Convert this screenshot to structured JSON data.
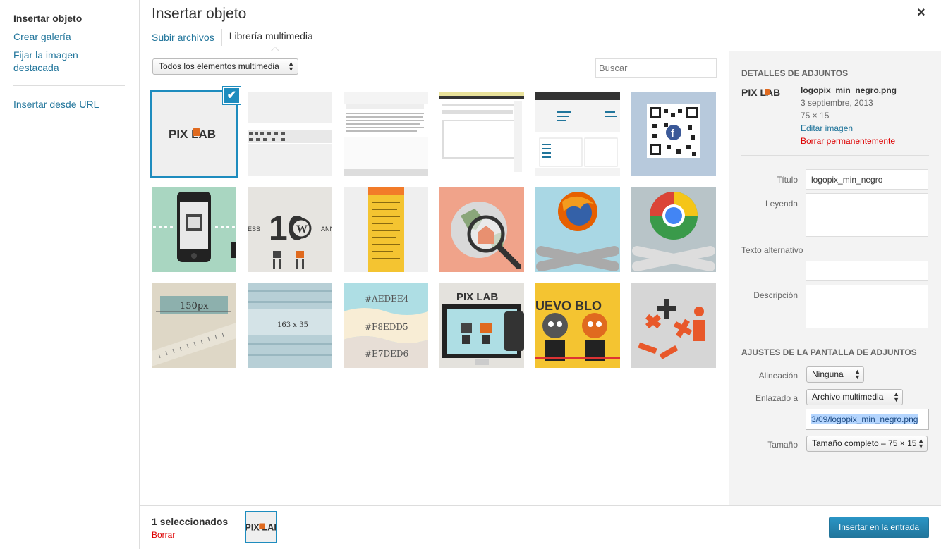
{
  "menu": {
    "items": [
      {
        "label": "Insertar objeto"
      },
      {
        "label": "Crear galería"
      },
      {
        "label": "Fijar la imagen destacada"
      },
      {
        "label": "Insertar desde URL"
      }
    ]
  },
  "frame": {
    "title": "Insertar objeto",
    "close": "×",
    "tabs": [
      {
        "label": "Subir archivos"
      },
      {
        "label": "Librería multimedia"
      }
    ]
  },
  "toolbar": {
    "filter": "Todos los elementos multimedia",
    "search_placeholder": "Buscar"
  },
  "grid": {
    "checkmark": "✔",
    "thumb_texts": {
      "pixlab": "PIX LAB",
      "px": "150px",
      "dims": "163 x 35",
      "hex1": "#AEDEE4",
      "hex2": "#F8EDD5",
      "hex3": "#E7DED6",
      "anniv": "10",
      "nuevo": "UEVO BLO",
      "ess": "ESS",
      "ann": "ANN"
    }
  },
  "details": {
    "heading": "DETALLES DE ADJUNTOS",
    "filename": "logopix_min_negro.png",
    "date": "3 septiembre, 2013",
    "dimensions": "75 × 15",
    "edit_link": "Editar imagen",
    "delete_link": "Borrar permanentemente",
    "fields": {
      "title_label": "Título",
      "title_value": "logopix_min_negro",
      "caption_label": "Leyenda",
      "alt_label": "Texto alternativo",
      "desc_label": "Descripción"
    }
  },
  "display": {
    "heading": "AJUSTES DE LA PANTALLA DE ADJUNTOS",
    "align_label": "Alineación",
    "align_value": "Ninguna",
    "link_label": "Enlazado a",
    "link_value": "Archivo multimedia",
    "url_value": "3/09/logopix_min_negro.png",
    "size_label": "Tamaño",
    "size_value": "Tamaño completo – 75 × 15"
  },
  "footer": {
    "selected": "1 seleccionados",
    "clear": "Borrar",
    "insert": "Insertar en la entrada"
  },
  "colors": {
    "link": "#21759b",
    "danger": "#dd0000",
    "accent": "#1e8cbe"
  }
}
